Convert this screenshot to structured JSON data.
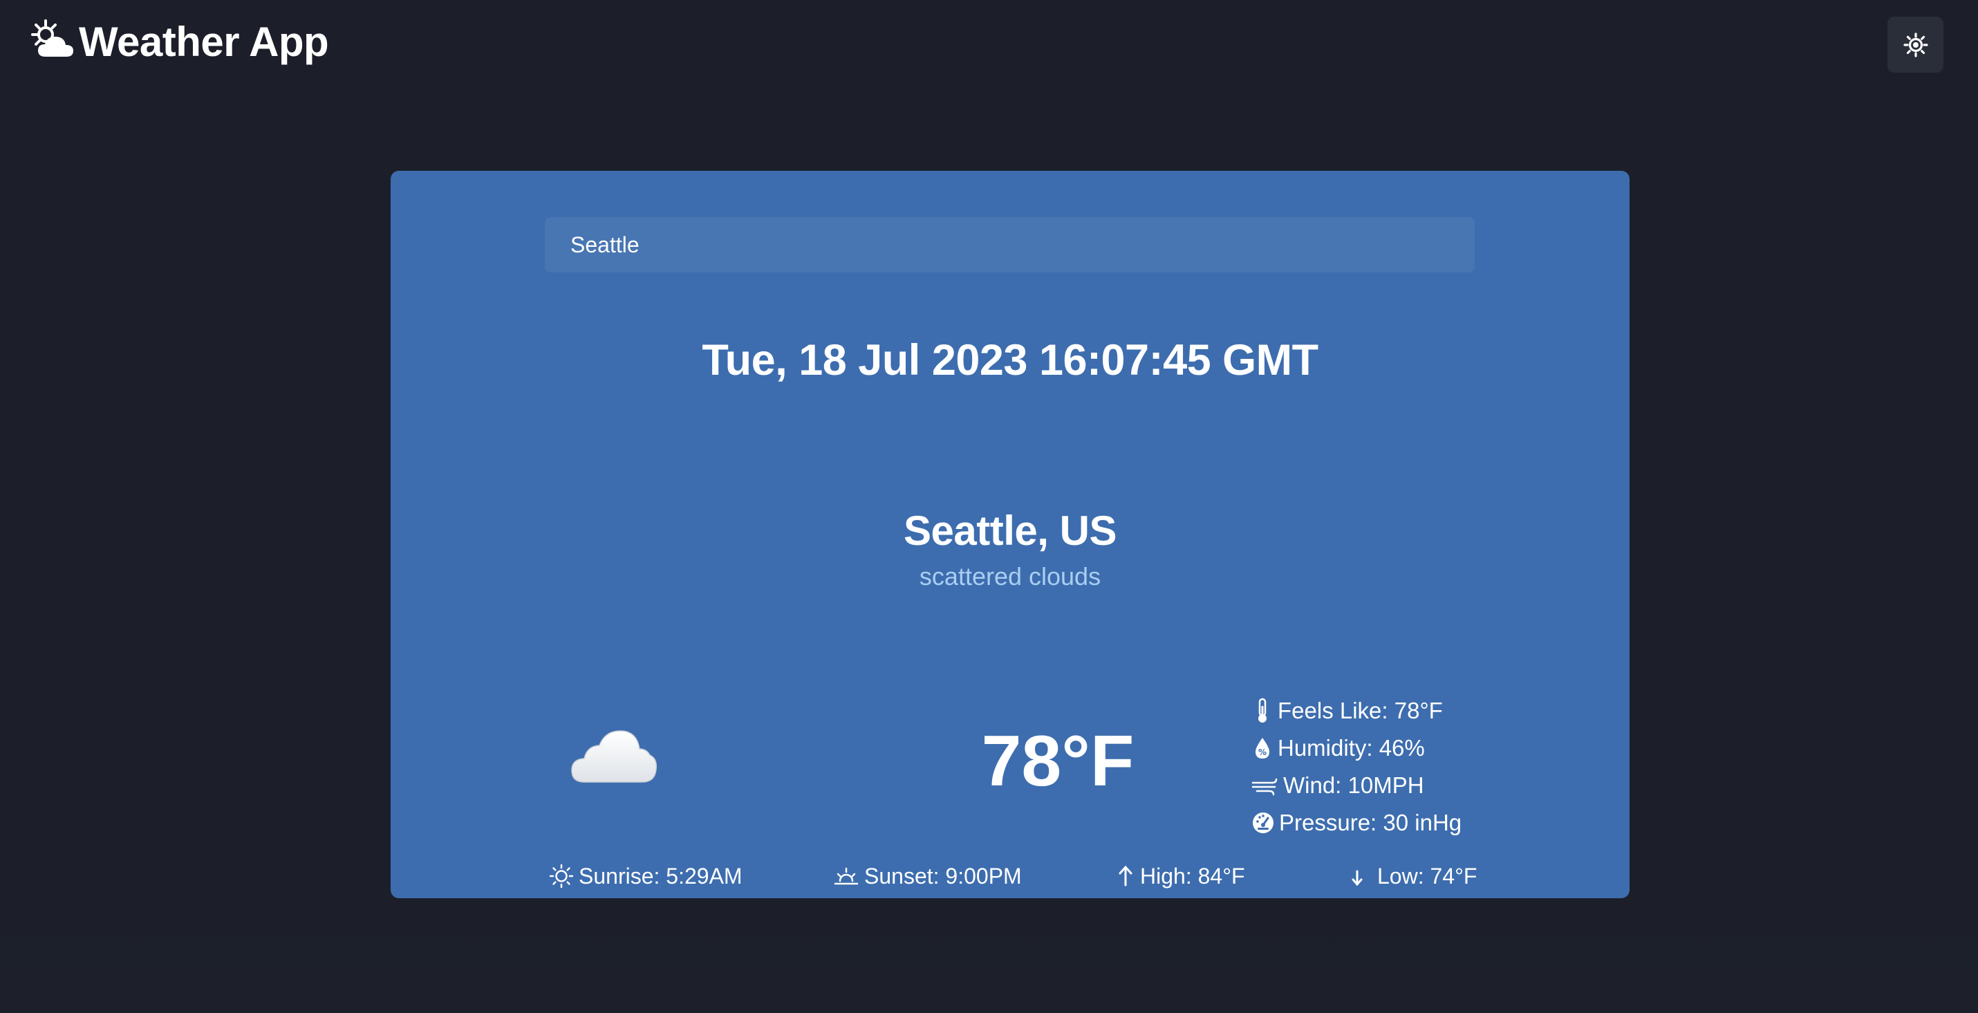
{
  "header": {
    "title": "Weather App",
    "logo_icon": "sun-behind-cloud-icon",
    "theme_toggle_icon": "sun-icon"
  },
  "search": {
    "value": "Seattle"
  },
  "current": {
    "datetime": "Tue, 18 Jul 2023 16:07:45 GMT",
    "location": "Seattle, US",
    "condition": "scattered clouds",
    "condition_icon": "cloud-icon",
    "temperature": "78°F"
  },
  "details": {
    "feels_like": "Feels Like: 78°F",
    "humidity": "Humidity: 46%",
    "wind": "Wind: 10MPH",
    "pressure": "Pressure: 30 inHg"
  },
  "footer": {
    "sunrise": "Sunrise: 5:29AM",
    "sunset": "Sunset: 9:00PM",
    "high": "High: 84°F",
    "low": "Low: 74°F"
  },
  "colors": {
    "background": "#1c1f29",
    "card": "#3d6dae",
    "search_bg": "#4876b2",
    "condition_text": "#a9cef3",
    "theme_button": "#2a2e39"
  }
}
